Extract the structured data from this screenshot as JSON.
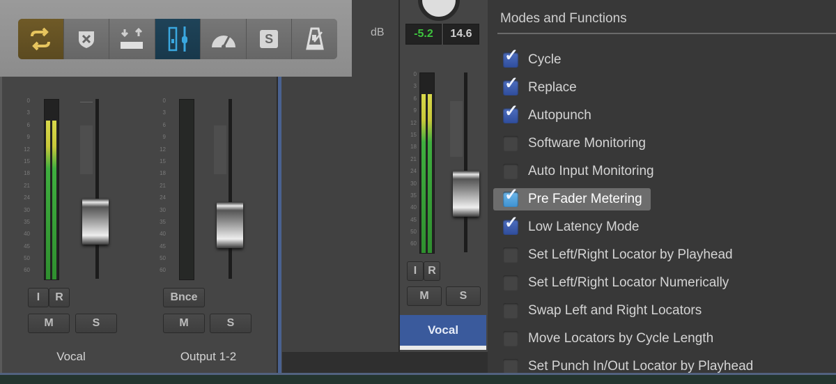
{
  "toolbar": {
    "buttons": [
      {
        "name": "cycle-button",
        "icon": "cycle-arrows-icon",
        "active": true,
        "color": "#e0c060"
      },
      {
        "name": "replace-button",
        "icon": "replace-shield-x-icon",
        "active": false
      },
      {
        "name": "autopunch-button",
        "icon": "autopunch-arrows-icon",
        "active": false
      },
      {
        "name": "low-latency-button",
        "icon": "low-latency-fader-icon",
        "active": true,
        "color": "#3aa8e0"
      },
      {
        "name": "performance-meter-button",
        "icon": "gauge-icon",
        "active": false
      },
      {
        "name": "solo-button",
        "icon": "solo-s-icon",
        "label": "S",
        "active": false
      },
      {
        "name": "metronome-button",
        "icon": "metronome-icon",
        "active": false
      }
    ]
  },
  "meter_scale": [
    "0",
    "3",
    "6",
    "9",
    "12",
    "15",
    "18",
    "21",
    "24",
    "30",
    "35",
    "40",
    "45",
    "50",
    "60"
  ],
  "strips": [
    {
      "name": "Vocal",
      "meter_level": 0.88,
      "has_signal": true,
      "input_btn": "I",
      "record_btn": "R",
      "mute": "M",
      "solo": "S"
    },
    {
      "name": "Output 1-2",
      "meter_level": 0,
      "has_signal": false,
      "bounce_btn": "Bnce",
      "mute": "M",
      "solo": "S"
    },
    {
      "name": "Vocal",
      "meter_level": 0.88,
      "has_signal": true,
      "input_btn": "I",
      "record_btn": "R",
      "mute": "M",
      "solo": "S",
      "selected": true
    }
  ],
  "readout": {
    "db_label": "dB",
    "level": "-5.2",
    "peak": "14.6",
    "level_color": "#3ec43e"
  },
  "modes_panel": {
    "title": "Modes and Functions",
    "options": [
      {
        "label": "Cycle",
        "checked": true
      },
      {
        "label": "Replace",
        "checked": true
      },
      {
        "label": "Autopunch",
        "checked": true
      },
      {
        "label": "Software Monitoring",
        "checked": false
      },
      {
        "label": "Auto Input Monitoring",
        "checked": false
      },
      {
        "label": "Pre Fader Metering",
        "checked": true,
        "highlighted": true
      },
      {
        "label": "Low Latency Mode",
        "checked": true
      },
      {
        "label": "Set Left/Right Locator by Playhead",
        "checked": false
      },
      {
        "label": "Set Left/Right Locator Numerically",
        "checked": false
      },
      {
        "label": "Swap Left and Right Locators",
        "checked": false
      },
      {
        "label": "Move Locators by Cycle Length",
        "checked": false
      },
      {
        "label": "Set Punch In/Out Locator by Playhead",
        "checked": false
      }
    ]
  },
  "colors": {
    "selected_strip": "#3a5a9c",
    "checkbox_on": "#3d5db0",
    "meter_green": "#3fae3f",
    "meter_yellow": "#d8d84a"
  }
}
